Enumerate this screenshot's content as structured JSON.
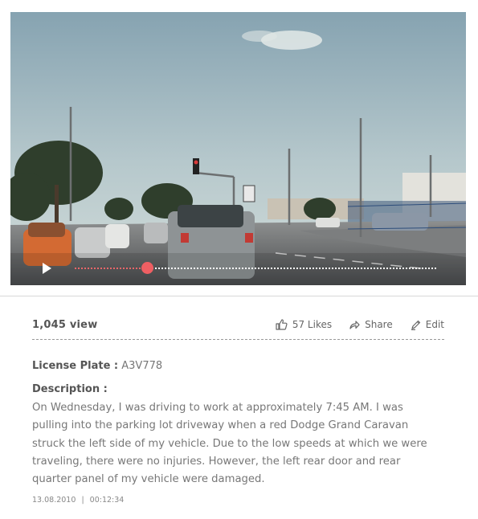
{
  "video": {
    "played_fraction": 0.2
  },
  "stats": {
    "views": "1,045 view",
    "likes": "57 Likes",
    "share": "Share",
    "edit": "Edit"
  },
  "details": {
    "plate_label": "License Plate :",
    "plate_value": "A3V778",
    "description_label": "Description :",
    "description_text": "On Wednesday, I was driving to work at approximately 7:45 AM. I was pulling into the parking lot driveway when a red Dodge Grand Caravan struck the left side of my vehicle. Due to the low speeds at which we were traveling, there were no injuries. However, the left rear door and rear quarter panel of my vehicle were damaged.",
    "date": "13.08.2010",
    "separator": "|",
    "time": "00:12:34"
  },
  "colors": {
    "accent": "#ef5f63",
    "text": "#777777",
    "heading": "#555555"
  },
  "icons": {
    "play": "play-icon",
    "like": "thumbs-up-icon",
    "share": "share-arrow-icon",
    "edit": "pencil-icon"
  }
}
